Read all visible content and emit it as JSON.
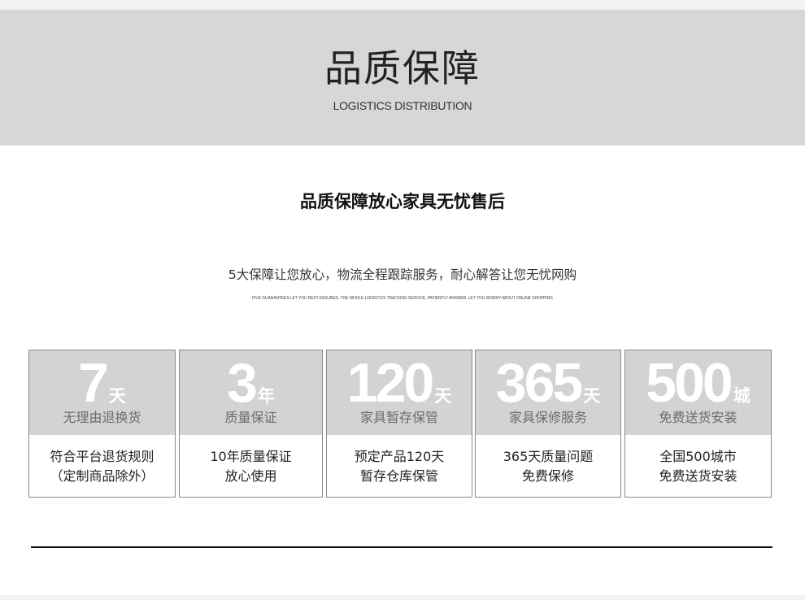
{
  "banner": {
    "title": "品质保障",
    "subtitle": "LOGISTICS DISTRIBUTION"
  },
  "headline": "品质保障放心家具无忧售后",
  "intro": {
    "text": "5大保障让您放心，物流全程跟踪服务，耐心解答让您无忧网购",
    "english": "FIVE GUARANTEES LET YOU REST ASSURED, THE WHOLE LOGISTICS TRACKING SERVICE, PATIENTLY ANSWER, LET YOU WORRY ABOUT ONLINE SHOPPING"
  },
  "cards": [
    {
      "number": "7",
      "unit": "天",
      "caption": "无理由退换货",
      "desc_line1": "符合平台退货规则",
      "desc_line2": "（定制商品除外）"
    },
    {
      "number": "3",
      "unit": "年",
      "caption": "质量保证",
      "desc_line1": "10年质量保证",
      "desc_line2": "放心使用"
    },
    {
      "number": "120",
      "unit": "天",
      "caption": "家具暂存保管",
      "desc_line1": "预定产品120天",
      "desc_line2": "暂存仓库保管"
    },
    {
      "number": "365",
      "unit": "天",
      "caption": "家具保修服务",
      "desc_line1": "365天质量问题",
      "desc_line2": "免费保修"
    },
    {
      "number": "500",
      "unit": "城",
      "caption": "免费送货安装",
      "desc_line1": "全国500城市",
      "desc_line2": "免费送货安装"
    }
  ],
  "colors": {
    "banner_bg": "#d7d7d9",
    "card_top_bg": "#d3d3d5",
    "card_border": "#8a8a8a",
    "big_number": "#ffffff",
    "divider": "#111111"
  }
}
